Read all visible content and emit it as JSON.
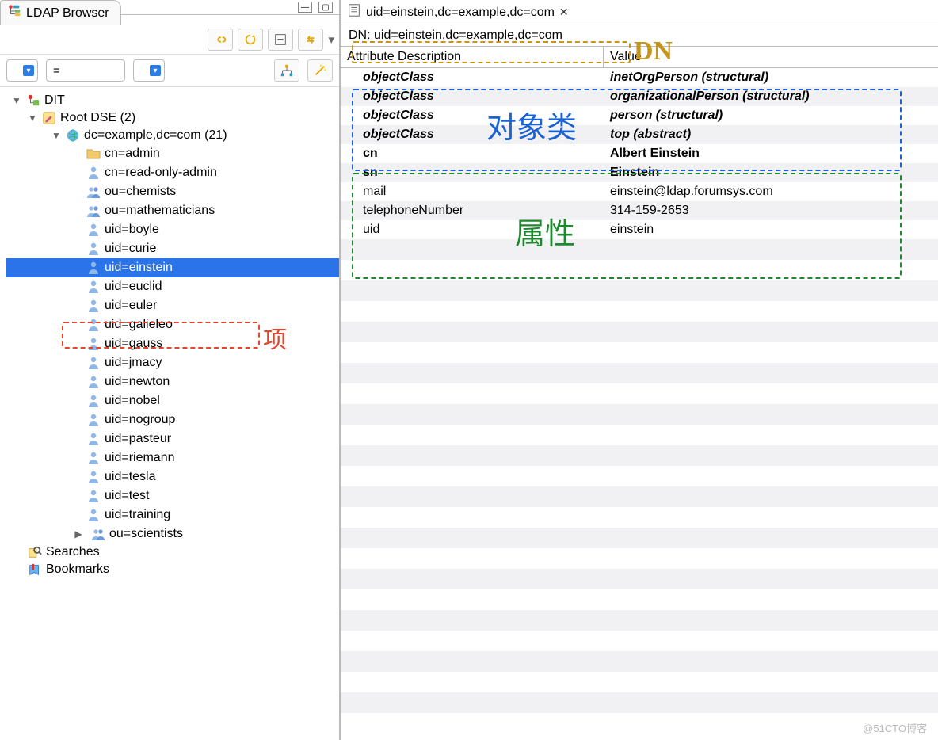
{
  "leftTab": {
    "title": "LDAP Browser"
  },
  "filter": {
    "operator": "="
  },
  "tree": {
    "root": "DIT",
    "rootdse": "Root DSE (2)",
    "base": "dc=example,dc=com (21)",
    "children": [
      "cn=admin",
      "cn=read-only-admin",
      "ou=chemists",
      "ou=mathematicians",
      "uid=boyle",
      "uid=curie",
      "uid=einstein",
      "uid=euclid",
      "uid=euler",
      "uid=galieleo",
      "uid=gauss",
      "uid=jmacy",
      "uid=newton",
      "uid=nobel",
      "uid=nogroup",
      "uid=pasteur",
      "uid=riemann",
      "uid=tesla",
      "uid=test",
      "uid=training",
      "ou=scientists"
    ],
    "searches": "Searches",
    "bookmarks": "Bookmarks"
  },
  "rightTab": {
    "title": "uid=einstein,dc=example,dc=com"
  },
  "dn": {
    "label": "DN: uid=einstein,dc=example,dc=com"
  },
  "columns": {
    "attr": "Attribute Description",
    "value": "Value"
  },
  "objectClasses": [
    {
      "a": "objectClass",
      "v": "inetOrgPerson (structural)"
    },
    {
      "a": "objectClass",
      "v": "organizationalPerson (structural)"
    },
    {
      "a": "objectClass",
      "v": "person (structural)"
    },
    {
      "a": "objectClass",
      "v": "top (abstract)"
    }
  ],
  "attrs": [
    {
      "a": "cn",
      "v": "Albert Einstein",
      "bold": true
    },
    {
      "a": "sn",
      "v": "Einstein",
      "bold": true
    },
    {
      "a": "mail",
      "v": "einstein@ldap.forumsys.com",
      "bold": false
    },
    {
      "a": "telephoneNumber",
      "v": "314-159-2653",
      "bold": false
    },
    {
      "a": "uid",
      "v": "einstein",
      "bold": false
    }
  ],
  "annot": {
    "entry": "项",
    "dn": "DN",
    "objclass": "对象类",
    "attrs": "属性"
  },
  "watermark": "@51CTO博客"
}
